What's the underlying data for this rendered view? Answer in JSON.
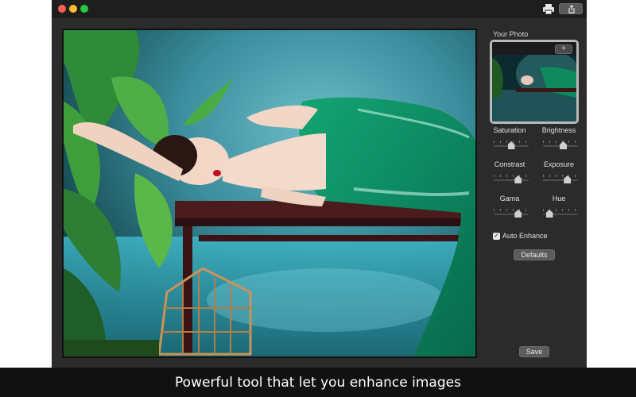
{
  "window": {
    "controls": [
      "close-button",
      "minimize-button",
      "maximize-button"
    ],
    "toolbar": {
      "print_icon": "printer-icon",
      "share_icon": "share-icon"
    }
  },
  "sidebar": {
    "title": "Your Photo",
    "add_button": "+",
    "controls": [
      {
        "label": "Saturation",
        "value": 0.5
      },
      {
        "label": "Brightness",
        "value": 0.6
      },
      {
        "label": "Constrast",
        "value": 0.75
      },
      {
        "label": "Exposure",
        "value": 0.75
      },
      {
        "label": "Gama",
        "value": 0.75
      },
      {
        "label": "Hue",
        "value": 0.1
      }
    ],
    "auto_enhance": {
      "label": "Auto Enhance",
      "checked": true
    },
    "defaults_button": "Defaults",
    "save_button": "Save"
  },
  "caption": "Powerful tool that let you enhance images",
  "colors": {
    "window_bg": "#2b2b2b",
    "titlebar": "#1e1e1e",
    "caption_bar": "#111111",
    "accent_dress": "#0f9a66"
  }
}
